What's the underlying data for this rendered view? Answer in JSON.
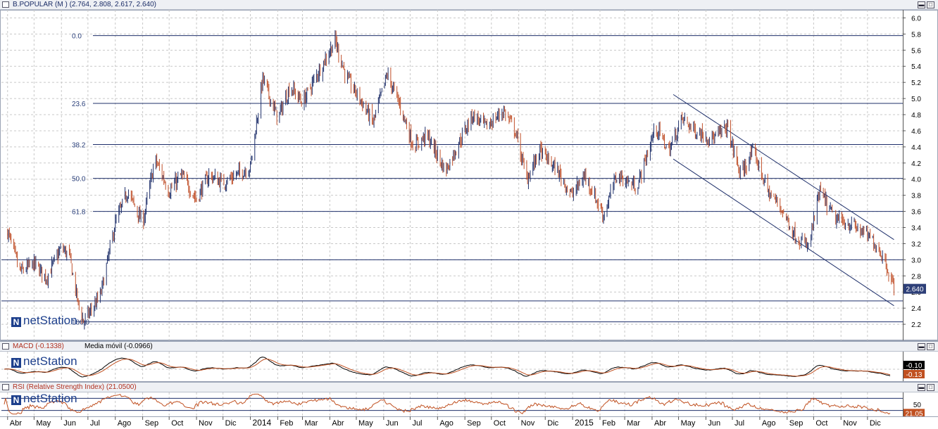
{
  "price_panel": {
    "title": "B.POPULAR (M ) (2.764, 2.808, 2.617, 2.640)",
    "last_value": "2.640",
    "logo": "netStation"
  },
  "macd_panel": {
    "title": "MACD (-0.1338)",
    "subtitle": "Media móvil (-0.0966)",
    "value_macd": "-0.10",
    "value_signal": "-0.13",
    "logo": "netStation"
  },
  "rsi_panel": {
    "title": "RSI (Relative Strength Index) (21.0500)",
    "value": "21.05",
    "logo": "netStation"
  },
  "chart_data": [
    {
      "type": "candlestick",
      "title": "B.POPULAR (M ) (2.764, 2.808, 2.617, 2.640)",
      "ylim": [
        2.0,
        6.1
      ],
      "y_ticks": [
        2.2,
        2.4,
        2.6,
        2.8,
        3.0,
        3.2,
        3.4,
        3.6,
        3.8,
        4.0,
        4.2,
        4.4,
        4.6,
        4.8,
        5.0,
        5.2,
        5.4,
        5.6,
        5.8,
        6.0
      ],
      "grid": true,
      "x_labels": [
        "Abr",
        "May",
        "Jun",
        "Jul",
        "Ago",
        "Sep",
        "Oct",
        "Nov",
        "Dic",
        "2014",
        "Feb",
        "Mar",
        "Abr",
        "May",
        "Jun",
        "Jul",
        "Ago",
        "Sep",
        "Oct",
        "Nov",
        "Dic",
        "2015",
        "Feb",
        "Mar",
        "Abr",
        "May",
        "Jun",
        "Jul",
        "Ago",
        "Sep",
        "Oct",
        "Nov",
        "Dic"
      ],
      "fibonacci_levels": [
        {
          "label": "0.0",
          "price": 5.78
        },
        {
          "label": "23.6",
          "price": 4.94
        },
        {
          "label": "38.2",
          "price": 4.43
        },
        {
          "label": "50.0",
          "price": 4.01
        },
        {
          "label": "61.8",
          "price": 3.6
        },
        {
          "label": "100.0",
          "price": 2.23
        }
      ],
      "horizontal_lines": [
        3.0,
        2.49
      ],
      "trend_channel": {
        "upper": {
          "from": [
            "2015-04-25",
            5.05
          ],
          "to": [
            "2015-12-31",
            3.25
          ]
        },
        "lower": {
          "from": [
            "2015-04-25",
            4.25
          ],
          "to": [
            "2015-12-31",
            2.43
          ]
        }
      },
      "last_close": 2.64,
      "path_points": [
        [
          "2013-04-01",
          3.35
        ],
        [
          "2013-04-15",
          2.85
        ],
        [
          "2013-05-01",
          2.95
        ],
        [
          "2013-05-15",
          2.78
        ],
        [
          "2013-06-01",
          3.15
        ],
        [
          "2013-06-10",
          3.05
        ],
        [
          "2013-06-20",
          2.45
        ],
        [
          "2013-06-26",
          2.23
        ],
        [
          "2013-07-15",
          2.55
        ],
        [
          "2013-08-01",
          3.45
        ],
        [
          "2013-08-15",
          3.85
        ],
        [
          "2013-09-01",
          3.45
        ],
        [
          "2013-09-15",
          4.25
        ],
        [
          "2013-10-01",
          3.85
        ],
        [
          "2013-10-15",
          4.05
        ],
        [
          "2013-11-01",
          3.75
        ],
        [
          "2013-11-15",
          4.05
        ],
        [
          "2013-12-01",
          3.95
        ],
        [
          "2013-12-15",
          4.05
        ],
        [
          "2014-01-01",
          4.15
        ],
        [
          "2014-01-15",
          5.25
        ],
        [
          "2014-02-01",
          4.75
        ],
        [
          "2014-02-15",
          5.15
        ],
        [
          "2014-03-01",
          4.95
        ],
        [
          "2014-03-20",
          5.35
        ],
        [
          "2014-04-07",
          5.72
        ],
        [
          "2014-04-20",
          5.25
        ],
        [
          "2014-05-05",
          5.0
        ],
        [
          "2014-05-20",
          4.7
        ],
        [
          "2014-06-05",
          5.3
        ],
        [
          "2014-06-20",
          4.9
        ],
        [
          "2014-07-05",
          4.4
        ],
        [
          "2014-07-20",
          4.55
        ],
        [
          "2014-08-10",
          4.1
        ],
        [
          "2014-08-25",
          4.45
        ],
        [
          "2014-09-10",
          4.8
        ],
        [
          "2014-09-25",
          4.65
        ],
        [
          "2014-10-15",
          4.85
        ],
        [
          "2014-10-28",
          4.6
        ],
        [
          "2014-11-10",
          4.0
        ],
        [
          "2014-11-25",
          4.35
        ],
        [
          "2014-12-15",
          4.1
        ],
        [
          "2014-12-31",
          3.8
        ],
        [
          "2015-01-15",
          4.05
        ],
        [
          "2015-02-05",
          3.55
        ],
        [
          "2015-02-20",
          4.05
        ],
        [
          "2015-03-15",
          3.9
        ],
        [
          "2015-04-05",
          4.65
        ],
        [
          "2015-04-20",
          4.35
        ],
        [
          "2015-05-05",
          4.75
        ],
        [
          "2015-05-20",
          4.6
        ],
        [
          "2015-06-10",
          4.5
        ],
        [
          "2015-06-25",
          4.65
        ],
        [
          "2015-07-10",
          4.05
        ],
        [
          "2015-07-25",
          4.35
        ],
        [
          "2015-08-10",
          3.85
        ],
        [
          "2015-08-25",
          3.65
        ],
        [
          "2015-09-10",
          3.3
        ],
        [
          "2015-09-25",
          3.15
        ],
        [
          "2015-10-08",
          3.85
        ],
        [
          "2015-10-25",
          3.5
        ],
        [
          "2015-11-10",
          3.45
        ],
        [
          "2015-11-25",
          3.35
        ],
        [
          "2015-12-10",
          3.2
        ],
        [
          "2015-12-20",
          3.02
        ],
        [
          "2015-12-31",
          2.64
        ]
      ]
    },
    {
      "type": "line",
      "title": "MACD (-0.1338)",
      "subtitle": "Media móvil (-0.0966)",
      "y_ticks": [
        0.0
      ],
      "series": [
        {
          "name": "MACD (-0.1338)",
          "color": "#000000"
        },
        {
          "name": "Media móvil (-0.0966)",
          "color": "#c05020"
        }
      ],
      "last_values": [
        -0.1,
        -0.13
      ]
    },
    {
      "type": "line",
      "title": "RSI (Relative Strength Index) (21.0500)",
      "y_ticks": [
        50
      ],
      "reference_lines": [
        30,
        70
      ],
      "series": [
        {
          "name": "RSI (Relative Strength Index) (21.0500)",
          "color": "#c05020"
        }
      ],
      "last_value": 21.05
    }
  ]
}
